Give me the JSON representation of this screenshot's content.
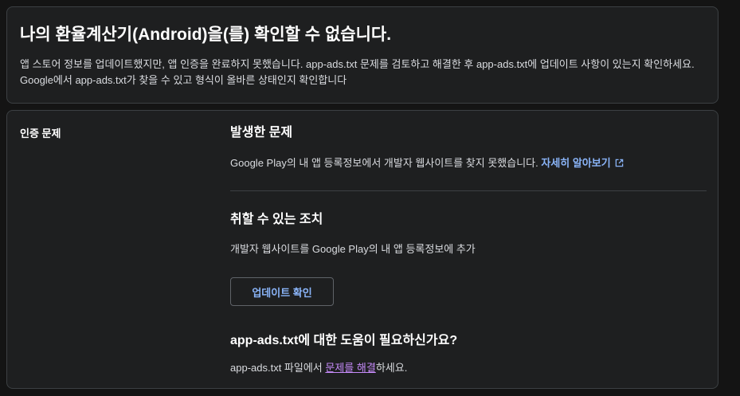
{
  "header": {
    "title": "나의 환율계산기(Android)을(를) 확인할 수 없습니다.",
    "description": "앱 스토어 정보를 업데이트했지만, 앱 인증을 완료하지 못했습니다. app-ads.txt 문제를 검토하고 해결한 후 app-ads.txt에 업데이트 사항이 있는지 확인하세요. Google에서 app-ads.txt가 찾을 수 있고 형식이 올바른 상태인지 확인합니다"
  },
  "issue": {
    "side_label": "인증 문제",
    "occurred_title": "발생한 문제",
    "occurred_text": "Google Play의 내 앱 등록정보에서 개발자 웹사이트를 찾지 못했습니다.",
    "learn_more": "자세히 알아보기",
    "action_title": "취할 수 있는 조치",
    "action_text": "개발자 웹사이트를 Google Play의 내 앱 등록정보에 추가",
    "update_button": "업데이트 확인",
    "help_title": "app-ads.txt에 대한 도움이 필요하신가요?",
    "help_prefix": "app-ads.txt 파일에서 ",
    "help_link": "문제를 해결",
    "help_suffix": "하세요."
  },
  "colors": {
    "background": "#141414",
    "card": "#1e1f20",
    "link": "#8ab4f8",
    "visited_link": "#c58af9"
  }
}
